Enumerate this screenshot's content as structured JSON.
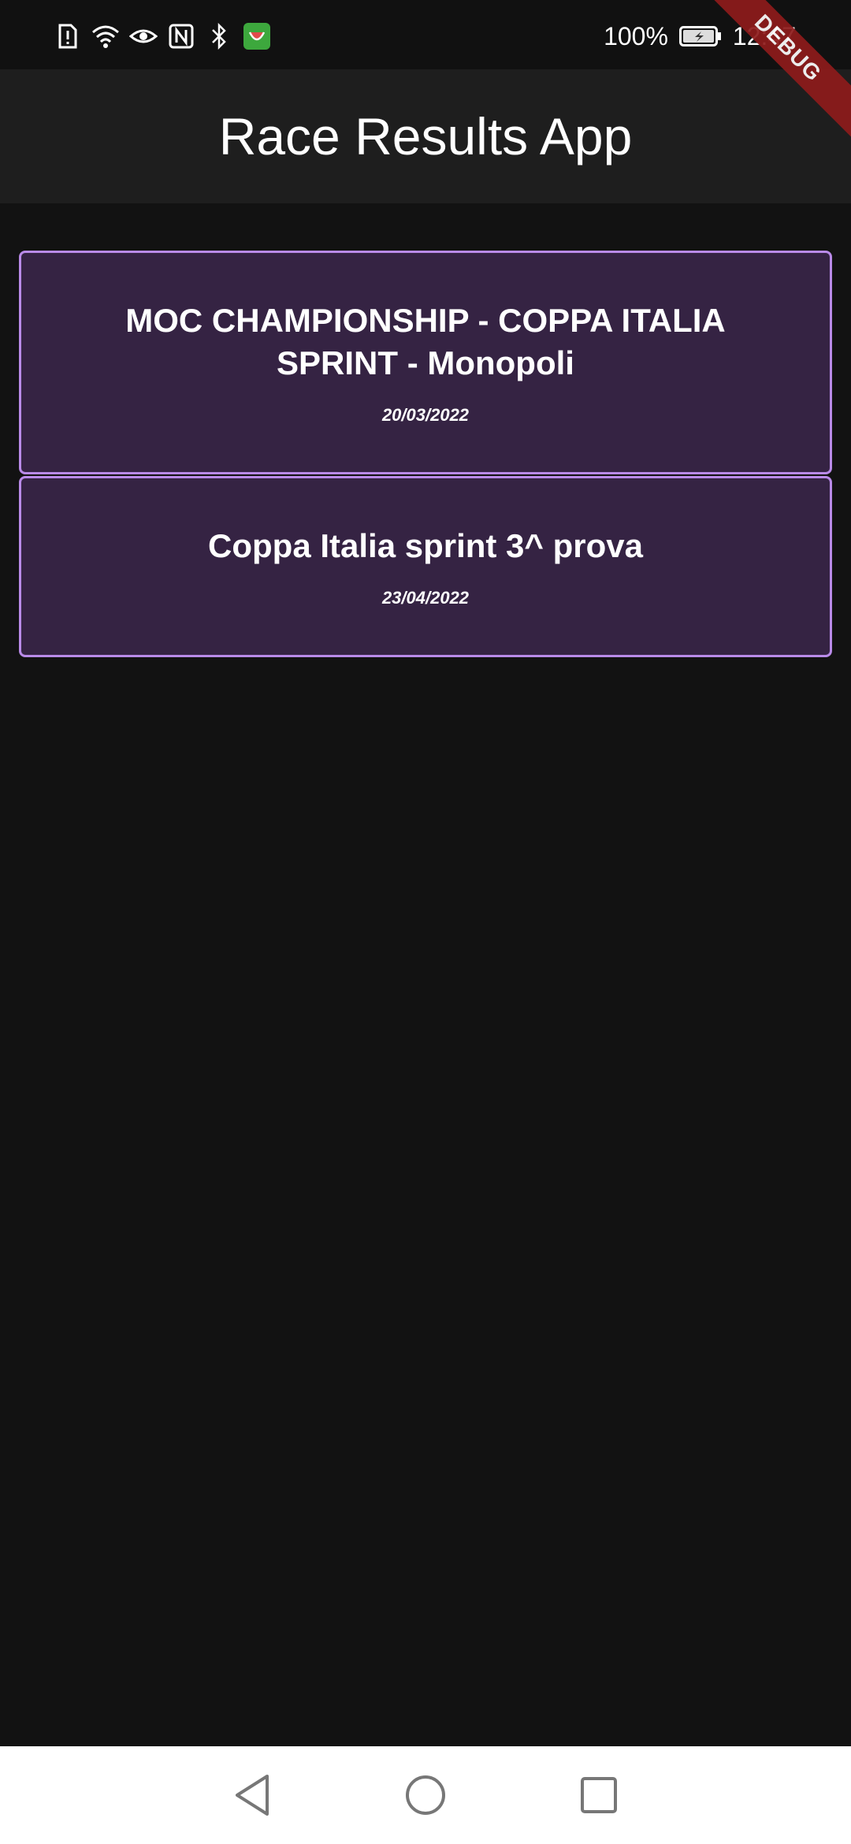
{
  "status_bar": {
    "icons": [
      "sim-alert-icon",
      "wifi-icon",
      "eye-icon",
      "nfc-icon",
      "bluetooth-icon",
      "app-notification-icon"
    ],
    "battery_percent": "100%",
    "time": "12:47"
  },
  "debug_banner": {
    "label": "DEBUG"
  },
  "app_bar": {
    "title": "Race Results App"
  },
  "races": [
    {
      "title": "MOC CHAMPIONSHIP - COPPA ITALIA SPRINT - Monopoli",
      "date": "20/03/2022"
    },
    {
      "title": "Coppa Italia sprint 3^ prova",
      "date": "23/04/2022"
    }
  ],
  "colors": {
    "background": "#121212",
    "app_bar": "#1e1e1e",
    "card_bg": "#352343",
    "card_border": "#b98ae8",
    "debug_ribbon": "#8e1b1b"
  },
  "nav_bar": {
    "buttons": [
      "back-icon",
      "home-icon",
      "recents-icon"
    ]
  }
}
